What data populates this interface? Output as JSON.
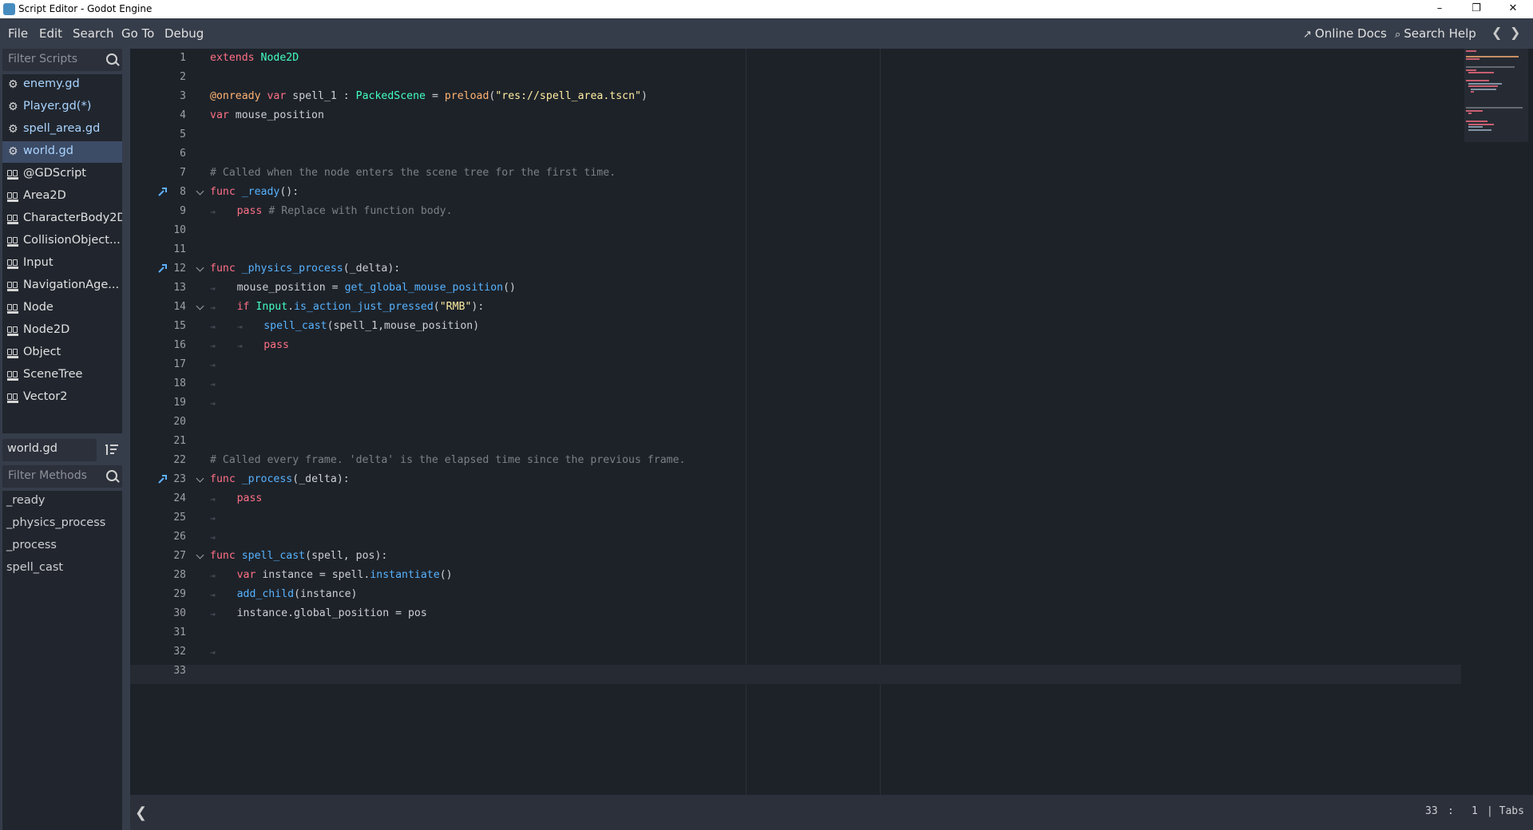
{
  "window": {
    "title": "Script Editor - Godot Engine"
  },
  "menu": {
    "items": [
      "File",
      "Edit",
      "Search",
      "Go To",
      "Debug"
    ],
    "online_docs": "Online Docs",
    "search_help": "Search Help"
  },
  "scripts_panel": {
    "filter_placeholder": "Filter Scripts",
    "items": [
      {
        "label": "enemy.gd",
        "icon": "gear-icon"
      },
      {
        "label": "Player.gd(*)",
        "icon": "gear-icon"
      },
      {
        "label": "spell_area.gd",
        "icon": "gear-icon"
      },
      {
        "label": "world.gd",
        "icon": "gear-icon",
        "selected": true
      },
      {
        "label": "@GDScript",
        "icon": "doc-icon"
      },
      {
        "label": "Area2D",
        "icon": "doc-icon"
      },
      {
        "label": "CharacterBody2D",
        "icon": "doc-icon"
      },
      {
        "label": "CollisionObject...",
        "icon": "doc-icon"
      },
      {
        "label": "Input",
        "icon": "doc-icon"
      },
      {
        "label": "NavigationAge...",
        "icon": "doc-icon"
      },
      {
        "label": "Node",
        "icon": "doc-icon"
      },
      {
        "label": "Node2D",
        "icon": "doc-icon"
      },
      {
        "label": "Object",
        "icon": "doc-icon"
      },
      {
        "label": "SceneTree",
        "icon": "doc-icon"
      },
      {
        "label": "Vector2",
        "icon": "doc-icon"
      }
    ],
    "current_file": "world.gd",
    "methods_filter_placeholder": "Filter Methods",
    "methods": [
      "_ready",
      "_physics_process",
      "_process",
      "spell_cast"
    ]
  },
  "editor": {
    "lines": [
      "extends Node2D",
      "",
      "@onready var spell_1 : PackedScene = preload(\"res://spell_area.tscn\")",
      "var mouse_position",
      "",
      "",
      "# Called when the node enters the scene tree for the first time.",
      "func _ready():",
      "\tpass # Replace with function body.",
      "",
      "",
      "func _physics_process(_delta):",
      "\tmouse_position = get_global_mouse_position()",
      "\tif Input.is_action_just_pressed(\"RMB\"):",
      "\t\tspell_cast(spell_1,mouse_position)",
      "\t\tpass",
      "\t",
      "\t",
      "\t",
      "",
      "",
      "# Called every frame. 'delta' is the elapsed time since the previous frame.",
      "func _process(_delta):",
      "\tpass",
      "\t",
      "\t",
      "func spell_cast(spell, pos):",
      "\tvar instance = spell.instantiate()",
      "\tadd_child(instance)",
      "\tinstance.global_position = pos",
      "",
      "\t",
      ""
    ],
    "foldable_lines": [
      8,
      12,
      14,
      23,
      27
    ],
    "override_lines": [
      8,
      12,
      23
    ],
    "current_line": 33
  },
  "statusbar": {
    "line": "33",
    "sep": ":",
    "column": "1",
    "indent": "| Tabs"
  },
  "colors": {
    "keyword": "#ff7085",
    "type": "#42ffc2",
    "function": "#57b3ff",
    "annotation": "#ffb373",
    "string": "#ffeda1",
    "comment": "#7b8088"
  }
}
